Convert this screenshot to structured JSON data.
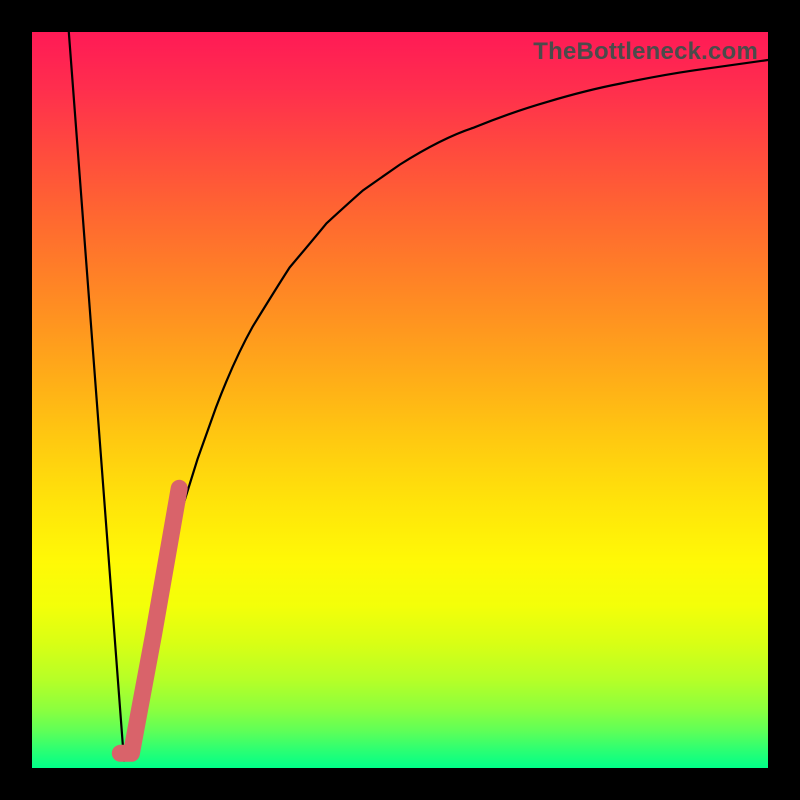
{
  "watermark": "TheBottleneck.com",
  "chart_data": {
    "type": "line",
    "title": "",
    "xlabel": "",
    "ylabel": "",
    "xlim": [
      0,
      100
    ],
    "ylim": [
      0,
      100
    ],
    "grid": false,
    "legend": false,
    "series": [
      {
        "name": "left-segment",
        "color": "#000000",
        "x": [
          5.0,
          12.5
        ],
        "values": [
          100.0,
          1.0
        ]
      },
      {
        "name": "right-curve",
        "color": "#000000",
        "x": [
          12.5,
          15,
          17.5,
          20,
          22.5,
          25,
          30,
          35,
          40,
          45,
          50,
          60,
          70,
          80,
          90,
          100
        ],
        "values": [
          1.0,
          12,
          24,
          34,
          42,
          49,
          60,
          68,
          74,
          78.5,
          82,
          87,
          90.5,
          93,
          94.8,
          96.2
        ]
      },
      {
        "name": "highlight-bar",
        "color": "#d9636a",
        "x": [
          12.0,
          13.5,
          16.5,
          20.0
        ],
        "values": [
          2.0,
          2.0,
          18.0,
          38.0
        ]
      }
    ],
    "gradient_stops": [
      {
        "pos": 0.0,
        "color": "#ff1a56"
      },
      {
        "pos": 0.5,
        "color": "#ffcb10"
      },
      {
        "pos": 0.8,
        "color": "#e8ff0c"
      },
      {
        "pos": 1.0,
        "color": "#00ff88"
      }
    ]
  }
}
